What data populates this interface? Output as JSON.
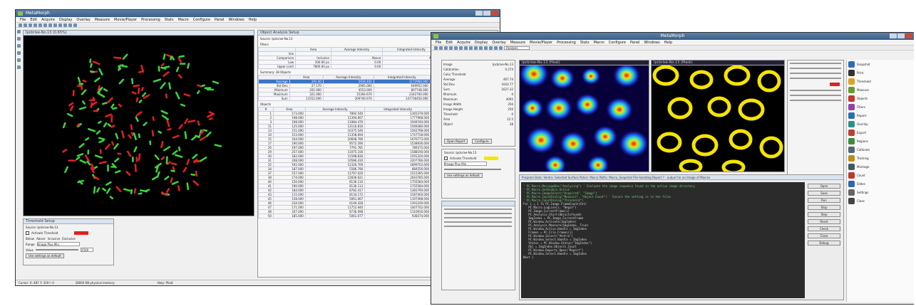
{
  "left_shot": {
    "title": "MetaMorph",
    "menu": [
      "File",
      "Edit",
      "Acquire",
      "Display",
      "Overlay",
      "Measure",
      "Movie/Player",
      "Processing",
      "Stats",
      "Macro",
      "Configure",
      "Panel",
      "Windows",
      "Help"
    ],
    "image_title": "Ipcbrixe-No.13 (0.65%)",
    "summary_panel_title": "Object Analysis Setup",
    "source_label": "Source: Ipcbrixe-No.13",
    "filters_label": "Filters",
    "filter_headers": [
      "",
      "Area",
      "Average Intensity",
      "Integrated Intensity",
      "Center X",
      "Center Y"
    ],
    "filter_rows": [
      [
        "Use",
        "",
        "",
        "",
        "",
        ""
      ],
      [
        "Comparison",
        "Inclusive",
        "Above",
        "Above",
        "Above",
        "Above"
      ],
      [
        "Low",
        "200.00 px",
        "0.00",
        "0.00",
        "0.00 px",
        "0.00 px"
      ],
      [
        "Upper Limit",
        "7800.00 px",
        "0.00",
        "0.00",
        "0.00 px",
        "0.00 px"
      ]
    ],
    "summary_label": "Summary: 38 Objects",
    "summary_headers": [
      "",
      "Area",
      "Average Intensity",
      "Integrated Intensity",
      "Center X",
      "Center Y"
    ],
    "summary_rows": [
      [
        "Average",
        "291.00",
        "5918.400",
        "1172968.000",
        "256.420",
        "241.280"
      ],
      [
        "Std Dev",
        "27.170",
        "2905.060",
        "649952.000",
        "117.560",
        "113.290"
      ],
      [
        "Minimum",
        "201.000",
        "4553.000",
        "807748.000",
        "26.160",
        "11.900"
      ],
      [
        "Maximum",
        "321.000",
        "15304.670",
        "2342760.000",
        "493.741",
        "497.910"
      ],
      [
        "Sum",
        "11552.000",
        "209740.670",
        "147736450.000",
        "25184.594",
        "22687.650"
      ]
    ],
    "objects_label": "Objects",
    "object_headers": [
      "#",
      "Area",
      "Average Intensity",
      "Integrated Intensity",
      "Center X",
      "Center Y"
    ],
    "object_rows": [
      [
        "1",
        "173.000",
        "7892.540",
        "1365379.000",
        "106.421",
        "11.007"
      ],
      [
        "2",
        "198.000",
        "11394.667",
        "1777968.000",
        "231.490",
        "32.160"
      ],
      [
        "3",
        "198.000",
        "11984.470",
        "1949740.000",
        "278.410",
        "42.900"
      ],
      [
        "11",
        "125.000",
        "12116.816",
        "1569380.000",
        "243.410",
        "66.908"
      ],
      [
        "13",
        "151.000",
        "10375.546",
        "1562798.000",
        "218.470",
        "86.439"
      ],
      [
        "14",
        "153.000",
        "11358.694",
        "1747728.000",
        "299.380",
        "88.479"
      ],
      [
        "15",
        "164.000",
        "10608.780",
        "1676773.000",
        "288.620",
        "88.907"
      ],
      [
        "17",
        "190.000",
        "9572.590",
        "1538936.000",
        "287.480",
        "106.551"
      ],
      [
        "26",
        "197.000",
        "7791.781",
        "789375.000",
        "415.900",
        "113.980"
      ],
      [
        "29",
        "257.000",
        "11075.156",
        "1588190.000",
        "222.880",
        "118.610"
      ],
      [
        "30",
        "182.000",
        "11598.830",
        "1591320.000",
        "407.900",
        "126.910"
      ],
      [
        "31",
        "208.000",
        "10586.410",
        "2207786.000",
        "221.672",
        "142.940"
      ],
      [
        "32",
        "192.000",
        "12326.700",
        "1899702.000",
        "132.050",
        "149.657"
      ],
      [
        "34",
        "187.000",
        "5586.790",
        "884556.000",
        "243.477",
        "195.155"
      ],
      [
        "37",
        "157.000",
        "11797.020",
        "1515395.000",
        "26.160",
        "160.315"
      ],
      [
        "38",
        "174.000",
        "12836.621",
        "2043785.000",
        "371.120",
        "177.621"
      ],
      [
        "40",
        "150.000",
        "8136.110",
        "1755584.000",
        "231.930",
        "184.203"
      ],
      [
        "41",
        "190.000",
        "8136.113",
        "1755584.000",
        "231.930",
        "184.930"
      ],
      [
        "42",
        "184.000",
        "8782.417",
        "1381790.000",
        "101.200",
        "188.170"
      ],
      [
        "43",
        "115.000",
        "8134.172",
        "1587400.000",
        "182.310",
        "193.640"
      ],
      [
        "45",
        "158.000",
        "5061.067",
        "1197498.000",
        "130.077",
        "199.473"
      ],
      [
        "46",
        "234.000",
        "6149.428",
        "1391249.000",
        "269.450",
        "171.350"
      ],
      [
        "47",
        "171.000",
        "11752.940",
        "1007702.000",
        "463.400",
        "176.030"
      ],
      [
        "48",
        "167.000",
        "8736.098",
        "1110916.000",
        "485.150",
        "178.930"
      ],
      [
        "50",
        "185.000",
        "5061.077",
        "938374.000",
        "272.776",
        "177.422"
      ]
    ],
    "threshold_panel_title": "Threshold Setup",
    "threshold_source": "Source: Ipcbrixe-No.13",
    "threshold_checkbox": "Activate Threshold",
    "threshold_modes": [
      "Below",
      "Above",
      "Inclusive",
      "Exclusive"
    ],
    "threshold_range_label": "Range",
    "threshold_range_value": "Image Plus Min",
    "threshold_value_label": "Value",
    "threshold_value": "2569",
    "threshold_button": "Use settings as default",
    "status_items": [
      "Cursor: X: 487 Y: 319 I: 0",
      "28004 KB physical memory",
      "",
      "Help: Phoit"
    ]
  },
  "right_shot": {
    "title": "MetaMorph",
    "menu": [
      "File",
      "Edit",
      "Acquire",
      "Display",
      "Overlay",
      "Measure",
      "Movie/Player",
      "Processing",
      "Stats",
      "Macro",
      "Configure",
      "Panel",
      "Windows",
      "Help"
    ],
    "analysis_dropdown": "Analysis",
    "heat_image_title": "Ipcbrixe-No.13 (Heat)",
    "mask_image_title": "Ipcbrixe-No.13 (Mask)",
    "stats_labels": [
      "Image",
      "Calibration",
      "Color Threshold",
      "Average",
      "Std Dev",
      "Sum",
      "Minimum",
      "Maximum",
      "Image Width",
      "Image Height",
      "Threshold",
      "Area",
      "Object"
    ],
    "stats_values": [
      "Ipcbrixe-No.13",
      "0.274",
      "",
      "467.74",
      "1043.77",
      "1627.32",
      "0",
      "4095",
      "256",
      "256",
      "0",
      "12.5",
      "38"
    ],
    "open_report_button": "Open Report",
    "configure_button": "Configure",
    "threshold_source": "Source: Ipcbrixe-No.13",
    "threshold_checkbox": "Activate Threshold",
    "threshold_range_value": "Image Plus Min",
    "threshold_button": "Use settings as default",
    "code_title": "Program Data: Ventra: Selected Surface Police: Macro Paths: Macro_Snapshot File-handling Report ? - output for an Image of Macros",
    "code_lines": [
      "' PC.Macro.MessageBox(\"Analyzing\") ' Evaluate the image sequence found in the active image directory",
      "' PC.Macro.SetEnable.Active",
      "' PC.Macro.ImageSelect(\"Acquired\", \"Image\")",
      "' PC.Macro.InputDialog(\"Measure\", \"Object Count\") ' Ensure the setting is in the files",
      "' PC.Macro.InputDialog(\"Threshold\")",
      "",
      "For i = 1 To PC.Image.FrameCount(Cnt)",
      "   PC.Macro.LogLine(i, \"Begin\")",
      "   PC.Image.CurrentFrame(i)",
      "   PC.Analysis.Start(ObjectsFound)",
      "   ImgIndex = PC.Image.CurrentFrame",
      "   PC.Window.Activate(ImgIndex)",
      "   PC.Analysis.Measure(ImgIndex, True)",
      "   PC.Window.Active.Handle = ImgIndex",
      "   Frames = PC.File.Frames(i)",
      "   PC.Window.Select(\"Ventra\")",
      "   PC.Window.Select.Handle = ImgIndex",
      "   Status = PC.Window.Status(\"ImgIndex\")",
      "   Obj = ImgIndex.Objects.Count",
      "   PC.Window.Reports.Open(\"Report\")",
      "   PC.Window.Select.Handle = ImgIndex",
      "Next i"
    ],
    "code_buttons": [
      "Open",
      "Save",
      "Run",
      "Stop",
      "Step",
      "Reset",
      "Check",
      "Close",
      "Debug"
    ],
    "side_items": [
      "Snapshot",
      "Print",
      "Threshold",
      "Measure",
      "Objects",
      "Filters",
      "Report",
      "Overlay",
      "Export",
      "Regions",
      "Calibrate",
      "Tracking",
      "Montage",
      "Count",
      "Slides",
      "Settings",
      "Close"
    ],
    "side_colors": [
      "#2f6db5",
      "#333333",
      "#e0a020",
      "#6a9a2f",
      "#c0392b",
      "#8e44ad",
      "#2f6db5",
      "#2a8f8f",
      "#b5442f",
      "#3d8b3d",
      "#556677",
      "#c08a1f",
      "#445566",
      "#c0392b",
      "#3366aa",
      "#666666",
      "#444444"
    ]
  }
}
